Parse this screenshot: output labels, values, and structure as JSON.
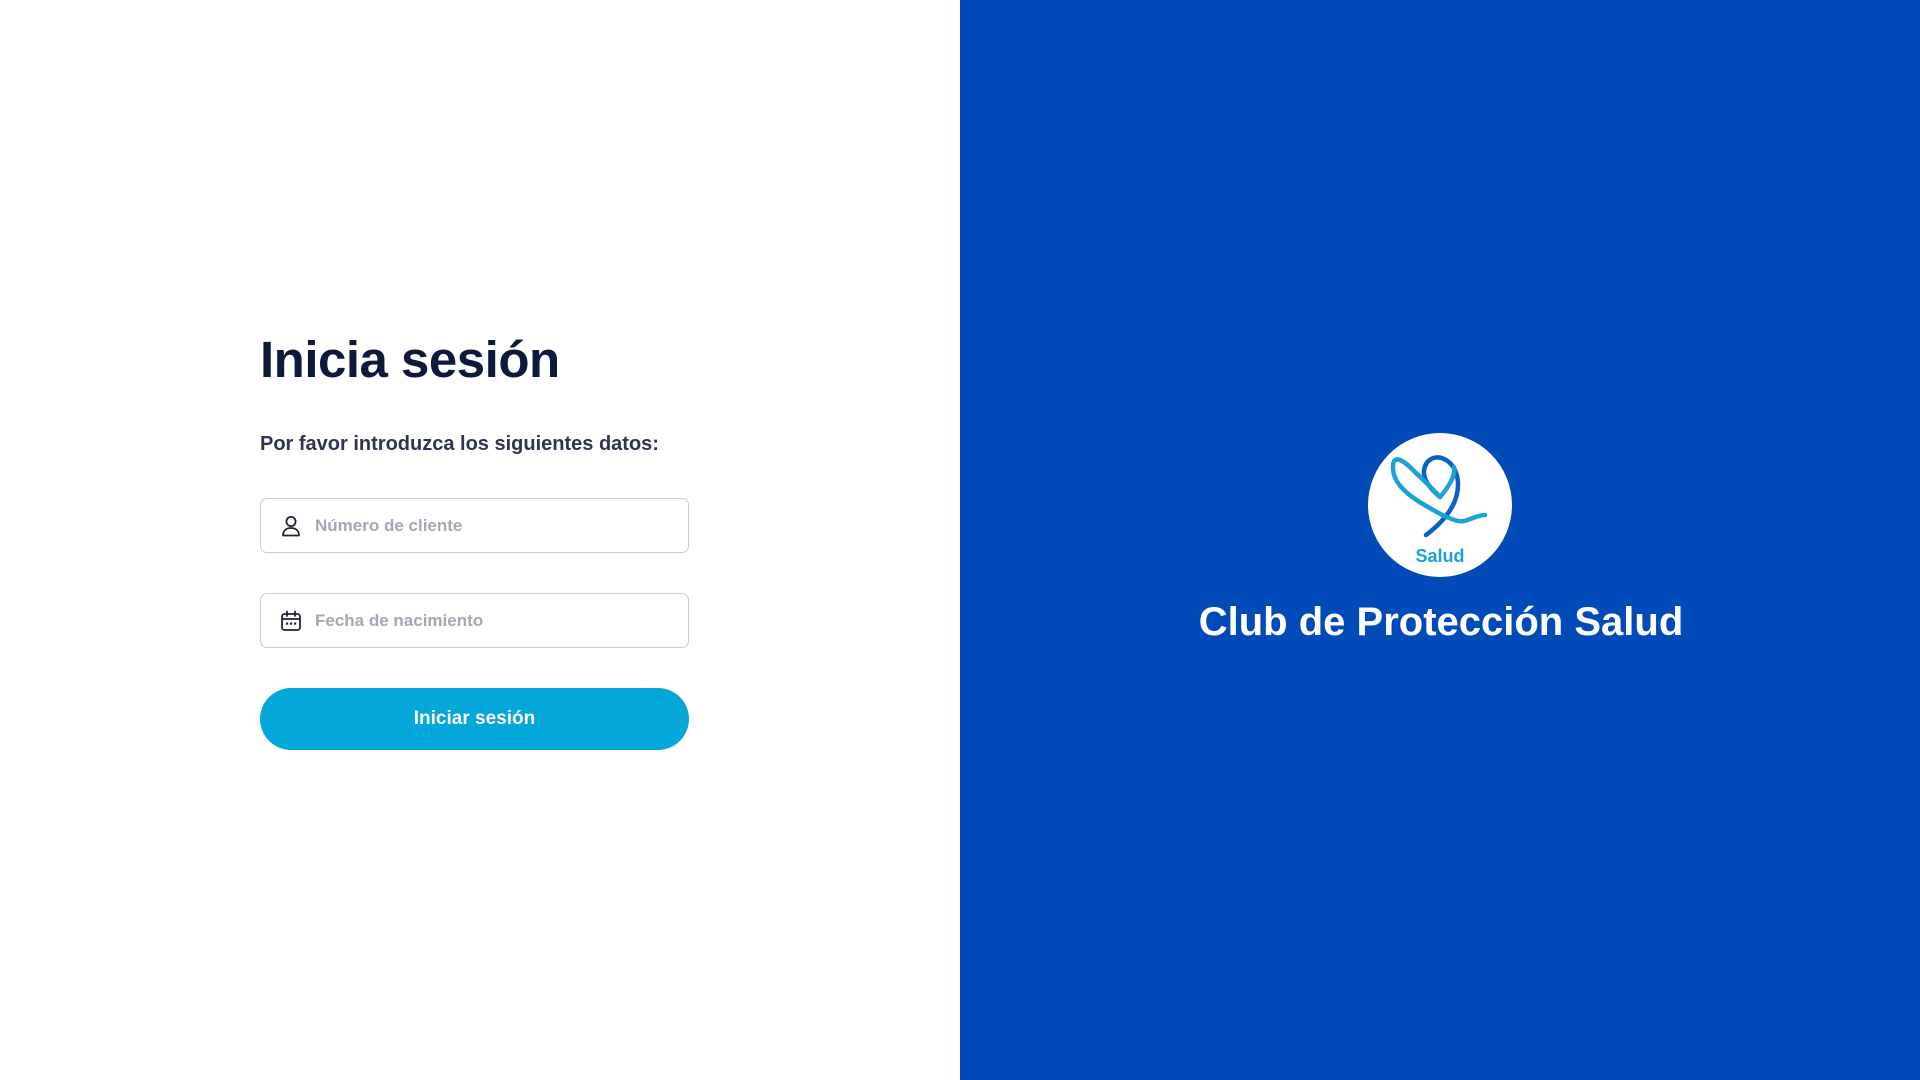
{
  "login": {
    "title": "Inicia sesión",
    "subtitle": "Por favor introduzca los siguientes datos:",
    "client_number": {
      "placeholder": "Número de cliente",
      "value": "",
      "icon": "user-icon"
    },
    "birth_date": {
      "placeholder": "Fecha de nacimiento",
      "value": "",
      "icon": "calendar-icon"
    },
    "submit_label": "Iniciar sesión"
  },
  "brand": {
    "logo_text": "Salud",
    "name": "Club de Protección Salud",
    "logo_icon": "heart-ribbon-logo"
  },
  "colors": {
    "brand_blue": "#014bb9",
    "accent_cyan": "#03a7d9",
    "title_navy": "#0f1a3a",
    "background": "#ffffff"
  }
}
